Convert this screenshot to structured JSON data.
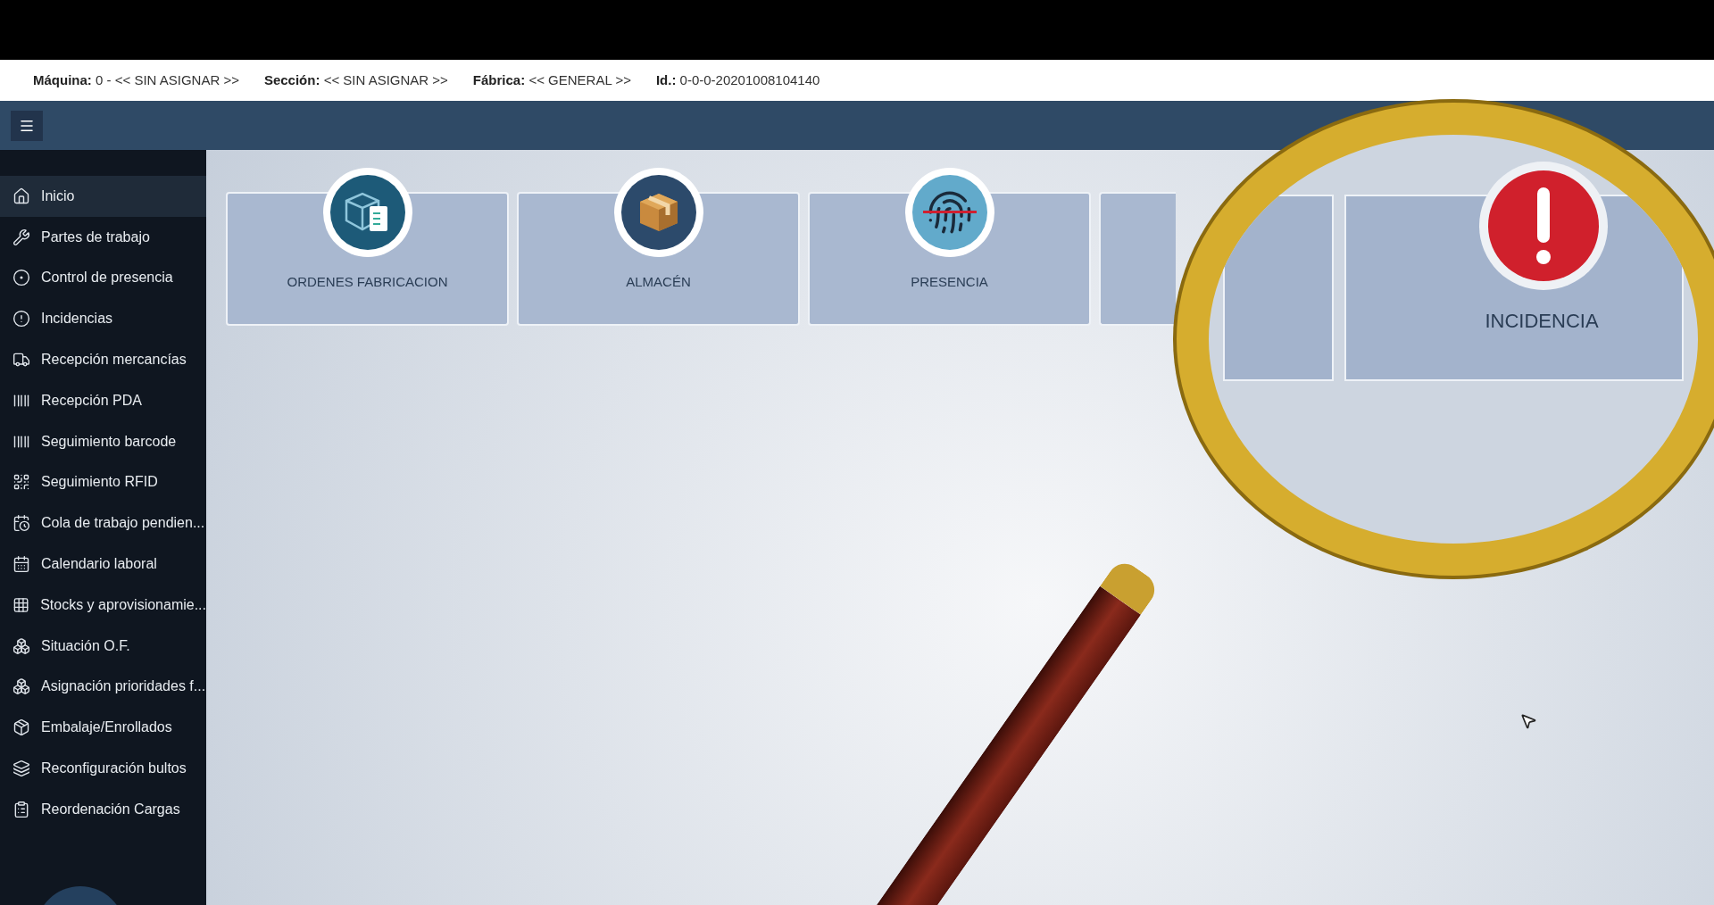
{
  "info_bar": [
    {
      "label": "Máquina:",
      "value": "0 - << SIN ASIGNAR >>"
    },
    {
      "label": "Sección:",
      "value": "<< SIN ASIGNAR >>"
    },
    {
      "label": "Fábrica:",
      "value": "<< GENERAL >>"
    },
    {
      "label": "Id.:",
      "value": "0-0-0-20201008104140"
    }
  ],
  "sidebar": {
    "items": [
      {
        "label": "Inicio",
        "selected": true
      },
      {
        "label": "Partes de trabajo",
        "selected": false
      },
      {
        "label": "Control de presencia",
        "selected": false
      },
      {
        "label": "Incidencias",
        "selected": false
      },
      {
        "label": "Recepción mercancías",
        "selected": false
      },
      {
        "label": "Recepción PDA",
        "selected": false
      },
      {
        "label": "Seguimiento barcode",
        "selected": false
      },
      {
        "label": "Seguimiento RFID",
        "selected": false
      },
      {
        "label": "Cola de trabajo pendien...",
        "selected": false
      },
      {
        "label": "Calendario laboral",
        "selected": false
      },
      {
        "label": "Stocks y aprovisionamie...",
        "selected": false
      },
      {
        "label": "Situación O.F.",
        "selected": false
      },
      {
        "label": "Asignación prioridades f...",
        "selected": false
      },
      {
        "label": "Embalaje/Enrollados",
        "selected": false
      },
      {
        "label": "Reconfiguración bultos",
        "selected": false
      },
      {
        "label": "Reordenación Cargas",
        "selected": false
      }
    ]
  },
  "tiles": [
    {
      "label": "ORDENES FABRICACION"
    },
    {
      "label": "ALMACÉN"
    },
    {
      "label": "PRESENCIA"
    }
  ],
  "magnifier": {
    "tile_label": "INCIDENCIA"
  }
}
